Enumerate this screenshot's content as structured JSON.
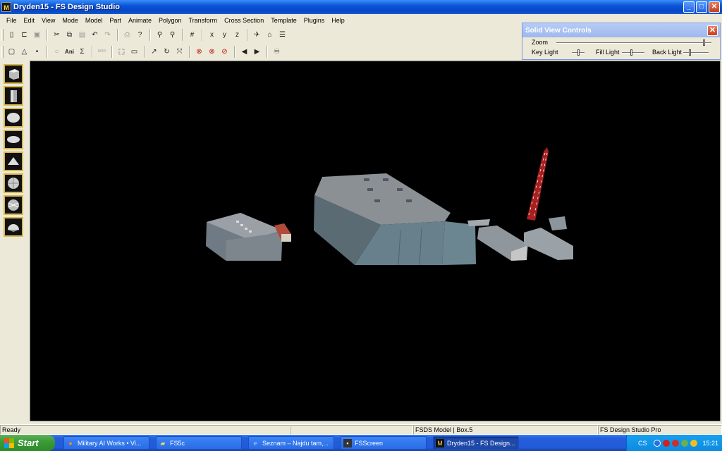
{
  "window": {
    "title": "Dryden15 - FS Design Studio",
    "app_icon": "fsds-icon",
    "controls": {
      "minimize": "_",
      "maximize": "□",
      "close": "✕"
    }
  },
  "menu": [
    "File",
    "Edit",
    "View",
    "Mode",
    "Model",
    "Part",
    "Animate",
    "Polygon",
    "Transform",
    "Cross Section",
    "Template",
    "Plugins",
    "Help"
  ],
  "toolbar1": [
    "new-icon",
    "open-icon",
    "save-icon",
    "cut-icon",
    "copy-icon",
    "paste-icon",
    "undo-icon",
    "redo-icon",
    "print-icon",
    "help-icon",
    "zoom-in-icon",
    "zoom-out-icon",
    "grid-icon",
    "axis-x-icon",
    "axis-y-icon",
    "axis-z-icon",
    "plane-icon",
    "home-icon",
    "properties-icon"
  ],
  "toolbar2": {
    "ani_label": "Ani",
    "sum_label": "Σ",
    "nodes_label": "NOD"
  },
  "solid_view_controls": {
    "title": "Solid View Controls",
    "zoom_label": "Zoom",
    "key_light_label": "Key Light",
    "fill_light_label": "Fill Light",
    "back_light_label": "Back Light",
    "zoom_level": 0.96,
    "key_light_level": 0.5,
    "fill_light_level": 0.4,
    "back_light_level": 0.25
  },
  "shape_tools": [
    "cube-icon",
    "cylinder-icon",
    "sphere-icon",
    "ellipsoid-icon",
    "pyramid-icon",
    "globe-icon",
    "geodesic-icon",
    "hemisphere-icon"
  ],
  "status": {
    "left": "Ready",
    "model": "FSDS Model | Box.5",
    "app": "FS Design Studio Pro"
  },
  "taskbar": {
    "start_label": "Start",
    "tasks": [
      {
        "label": "Military AI Works • Vi...",
        "icon": "firefox-icon"
      },
      {
        "label": "FS5c",
        "icon": "folder-icon"
      },
      {
        "label": "Seznam – Najdu tam,...",
        "icon": "ie-icon"
      },
      {
        "label": "FSScreen",
        "icon": "app-icon"
      },
      {
        "label": "Dryden15 - FS Design...",
        "icon": "fsds-icon"
      }
    ],
    "lang": "CS",
    "clock": "15:21"
  }
}
